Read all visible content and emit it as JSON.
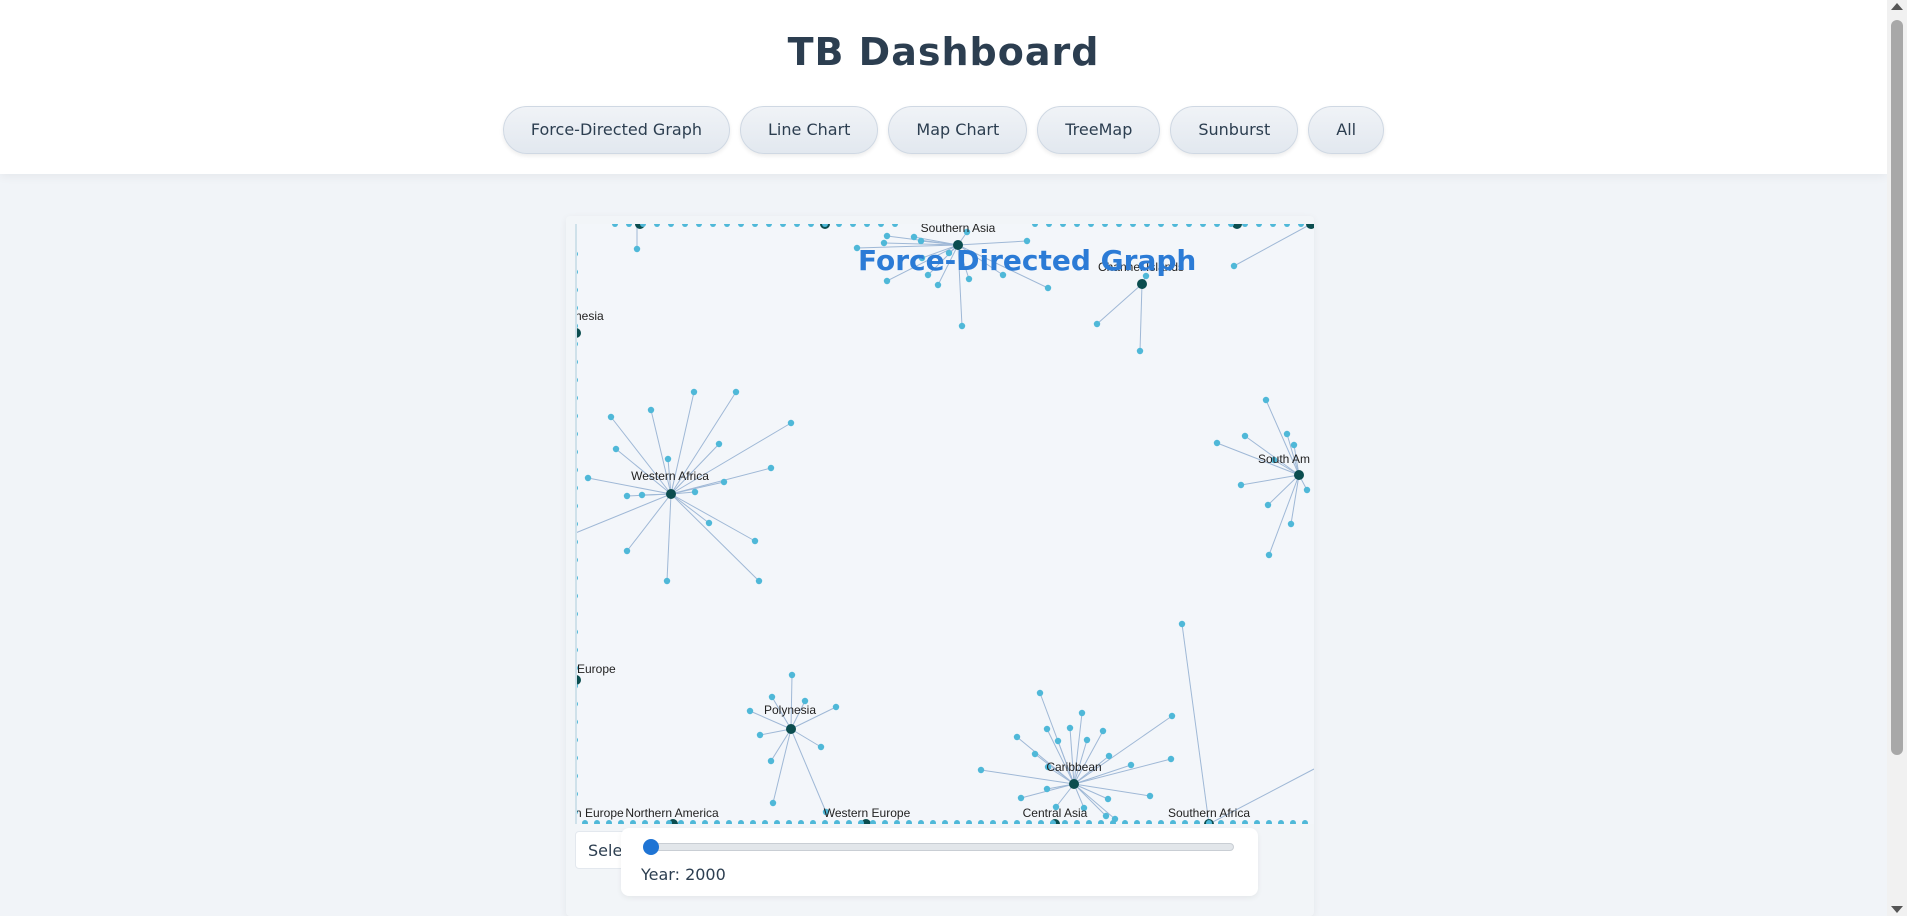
{
  "header": {
    "title": "TB Dashboard",
    "tabs": [
      {
        "label": "Force-Directed Graph"
      },
      {
        "label": "Line Chart"
      },
      {
        "label": "Map Chart"
      },
      {
        "label": "TreeMap"
      },
      {
        "label": "Sunburst"
      },
      {
        "label": "All"
      }
    ]
  },
  "graph": {
    "title": "Force-Directed Graph",
    "region_labels": {
      "southern_asia": "Southern Asia",
      "channel_islands": "Channel Islands",
      "melanesia_partial": "nesia",
      "western_africa": "Western Africa",
      "south_america_partial": "South Am",
      "europe_partial": "Europe",
      "polynesia": "Polynesia",
      "caribbean": "Caribbean",
      "n_europe_partial": "n Europe",
      "northern_america": "Northern America",
      "western_europe": "Western Europe",
      "central_asia": "Central Asia",
      "southern_africa": "Southern Africa"
    }
  },
  "controls": {
    "select_text": "Sele",
    "year_label": "Year: 2000",
    "year": 2000
  },
  "colors": {
    "hub": "#0b4d4f",
    "leaf": "#4fb8d8",
    "link": "#9fb8d6",
    "title": "#2b7bd6"
  }
}
